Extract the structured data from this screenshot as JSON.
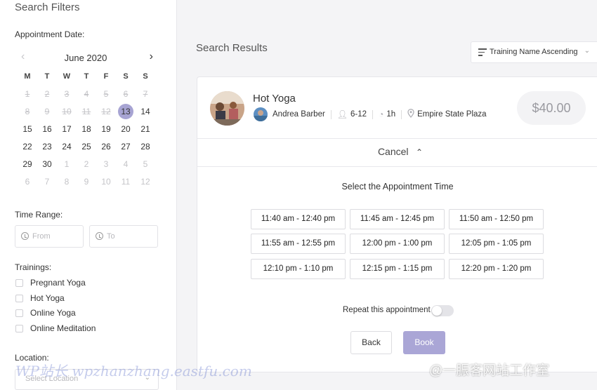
{
  "sidebar": {
    "title": "Search Filters",
    "date_label": "Appointment Date:",
    "calendar": {
      "month": "June 2020",
      "weekdays": [
        "M",
        "T",
        "W",
        "T",
        "F",
        "S",
        "S"
      ],
      "weeks": [
        [
          "1",
          "2",
          "3",
          "4",
          "5",
          "6",
          "7"
        ],
        [
          "8",
          "9",
          "10",
          "11",
          "12",
          "13",
          "14"
        ],
        [
          "15",
          "16",
          "17",
          "18",
          "19",
          "20",
          "21"
        ],
        [
          "22",
          "23",
          "24",
          "25",
          "26",
          "27",
          "28"
        ],
        [
          "29",
          "30",
          "1",
          "2",
          "3",
          "4",
          "5"
        ],
        [
          "6",
          "7",
          "8",
          "9",
          "10",
          "11",
          "12"
        ]
      ],
      "selected_day": "13"
    },
    "time_range_label": "Time Range:",
    "from_placeholder": "From",
    "to_placeholder": "To",
    "trainings_label": "Trainings:",
    "trainings": [
      "Pregnant Yoga",
      "Hot Yoga",
      "Online Yoga",
      "Online Meditation"
    ],
    "location_label": "Location:",
    "location_placeholder": "Select Location"
  },
  "main": {
    "title": "Search Results",
    "sort_label": "Training Name Ascending",
    "card": {
      "title": "Hot Yoga",
      "instructor": "Andrea Barber",
      "capacity": "6-12",
      "duration": "1h",
      "location": "Empire State Plaza",
      "price": "$40.00",
      "cancel_label": "Cancel",
      "select_title": "Select the Appointment Time",
      "slots": [
        "11:40 am - 12:40 pm",
        "11:45 am - 12:45 pm",
        "11:50 am - 12:50 pm",
        "11:55 am - 12:55 pm",
        "12:00 pm - 1:00 pm",
        "12:05 pm - 1:05 pm",
        "12:10 pm - 1:10 pm",
        "12:15 pm - 1:15 pm",
        "12:20 pm - 1:20 pm"
      ],
      "repeat_label": "Repeat this appointment",
      "repeat_on": false,
      "back_label": "Back",
      "book_label": "Book"
    }
  },
  "watermarks": {
    "left": "WP站长 wpzhanzhang.eastfu.com",
    "right": "@一脤客网站工作室"
  },
  "colors": {
    "accent": "#a7a4d3",
    "book_button": "#aaa6d6",
    "background": "#f4f4f6"
  }
}
